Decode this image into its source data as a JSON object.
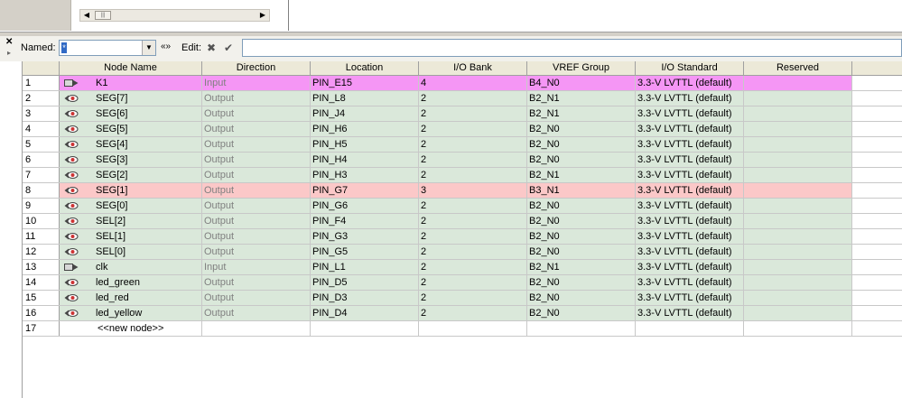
{
  "toolbar": {
    "named_label": "Named:",
    "named_value": "*",
    "edit_label": "Edit:",
    "edit_value": ""
  },
  "columns": [
    "",
    "Node Name",
    "Direction",
    "Location",
    "I/O Bank",
    "VREF Group",
    "I/O Standard",
    "Reserved"
  ],
  "rows": [
    {
      "num": "1",
      "icon": "input-pin",
      "name": "K1",
      "direction": "Input",
      "location": "PIN_E15",
      "bank": "4",
      "vref": "B4_N0",
      "standard": "3.3-V LVTTL (default)",
      "reserved": "",
      "color": "magenta"
    },
    {
      "num": "2",
      "icon": "output-pin",
      "name": "SEG[7]",
      "direction": "Output",
      "location": "PIN_L8",
      "bank": "2",
      "vref": "B2_N1",
      "standard": "3.3-V LVTTL (default)",
      "reserved": "",
      "color": "green"
    },
    {
      "num": "3",
      "icon": "output-pin",
      "name": "SEG[6]",
      "direction": "Output",
      "location": "PIN_J4",
      "bank": "2",
      "vref": "B2_N1",
      "standard": "3.3-V LVTTL (default)",
      "reserved": "",
      "color": "green"
    },
    {
      "num": "4",
      "icon": "output-pin",
      "name": "SEG[5]",
      "direction": "Output",
      "location": "PIN_H6",
      "bank": "2",
      "vref": "B2_N0",
      "standard": "3.3-V LVTTL (default)",
      "reserved": "",
      "color": "green"
    },
    {
      "num": "5",
      "icon": "output-pin",
      "name": "SEG[4]",
      "direction": "Output",
      "location": "PIN_H5",
      "bank": "2",
      "vref": "B2_N0",
      "standard": "3.3-V LVTTL (default)",
      "reserved": "",
      "color": "green"
    },
    {
      "num": "6",
      "icon": "output-pin",
      "name": "SEG[3]",
      "direction": "Output",
      "location": "PIN_H4",
      "bank": "2",
      "vref": "B2_N0",
      "standard": "3.3-V LVTTL (default)",
      "reserved": "",
      "color": "green"
    },
    {
      "num": "7",
      "icon": "output-pin",
      "name": "SEG[2]",
      "direction": "Output",
      "location": "PIN_H3",
      "bank": "2",
      "vref": "B2_N1",
      "standard": "3.3-V LVTTL (default)",
      "reserved": "",
      "color": "green"
    },
    {
      "num": "8",
      "icon": "output-pin",
      "name": "SEG[1]",
      "direction": "Output",
      "location": "PIN_G7",
      "bank": "3",
      "vref": "B3_N1",
      "standard": "3.3-V LVTTL (default)",
      "reserved": "",
      "color": "pink"
    },
    {
      "num": "9",
      "icon": "output-pin",
      "name": "SEG[0]",
      "direction": "Output",
      "location": "PIN_G6",
      "bank": "2",
      "vref": "B2_N0",
      "standard": "3.3-V LVTTL (default)",
      "reserved": "",
      "color": "green"
    },
    {
      "num": "10",
      "icon": "output-pin",
      "name": "SEL[2]",
      "direction": "Output",
      "location": "PIN_F4",
      "bank": "2",
      "vref": "B2_N0",
      "standard": "3.3-V LVTTL (default)",
      "reserved": "",
      "color": "green"
    },
    {
      "num": "11",
      "icon": "output-pin",
      "name": "SEL[1]",
      "direction": "Output",
      "location": "PIN_G3",
      "bank": "2",
      "vref": "B2_N0",
      "standard": "3.3-V LVTTL (default)",
      "reserved": "",
      "color": "green"
    },
    {
      "num": "12",
      "icon": "output-pin",
      "name": "SEL[0]",
      "direction": "Output",
      "location": "PIN_G5",
      "bank": "2",
      "vref": "B2_N0",
      "standard": "3.3-V LVTTL (default)",
      "reserved": "",
      "color": "green"
    },
    {
      "num": "13",
      "icon": "input-pin",
      "name": "clk",
      "direction": "Input",
      "location": "PIN_L1",
      "bank": "2",
      "vref": "B2_N1",
      "standard": "3.3-V LVTTL (default)",
      "reserved": "",
      "color": "green"
    },
    {
      "num": "14",
      "icon": "output-pin",
      "name": "led_green",
      "direction": "Output",
      "location": "PIN_D5",
      "bank": "2",
      "vref": "B2_N0",
      "standard": "3.3-V LVTTL (default)",
      "reserved": "",
      "color": "green"
    },
    {
      "num": "15",
      "icon": "output-pin",
      "name": "led_red",
      "direction": "Output",
      "location": "PIN_D3",
      "bank": "2",
      "vref": "B2_N0",
      "standard": "3.3-V LVTTL (default)",
      "reserved": "",
      "color": "green"
    },
    {
      "num": "16",
      "icon": "output-pin",
      "name": "led_yellow",
      "direction": "Output",
      "location": "PIN_D4",
      "bank": "2",
      "vref": "B2_N0",
      "standard": "3.3-V LVTTL (default)",
      "reserved": "",
      "color": "green"
    }
  ],
  "new_node_row": {
    "num": "17",
    "label": "<<new node>>"
  },
  "colors": {
    "magenta": "#f596f5",
    "green": "#dae8da",
    "pink": "#fbc8c8"
  }
}
